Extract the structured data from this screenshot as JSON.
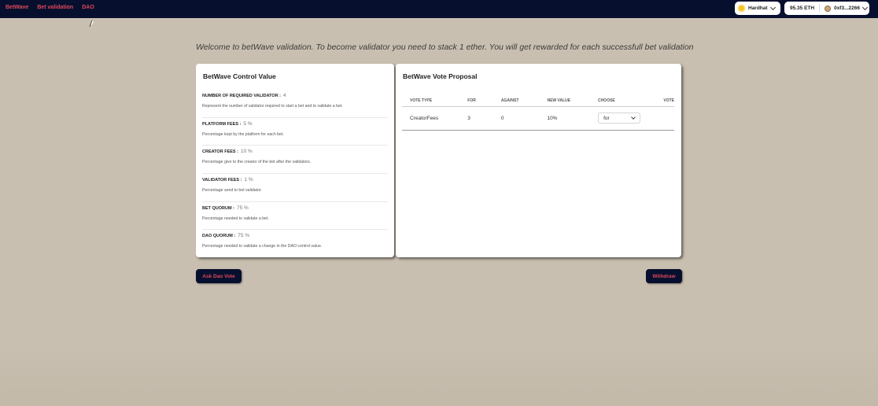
{
  "nav": {
    "brand": "BetWave",
    "links": [
      "Bet validation",
      "DAO"
    ]
  },
  "network": {
    "label": "Hardhat",
    "icon": "sun-icon"
  },
  "wallet": {
    "balance": "95.35 ETH",
    "address": "0xf3...2266"
  },
  "welcome": "Welcome to betWave validation. To become validator you need to stack 1 ether. You will get rewarded for each successfull bet validation",
  "control": {
    "title": "BetWave Control Value",
    "rows": [
      {
        "label": "NUMBER OF REQUIRED VALIDATOR :",
        "value": "4",
        "desc": "Represent the number of validator required to start a bet and to validate a bet."
      },
      {
        "label": "PLATFORM FEES :",
        "value": "5 %",
        "desc": "Percentage kept by the platform for each bet."
      },
      {
        "label": "CREATOR FEES :",
        "value": "10 %",
        "desc": "Percentage give to the creator of the bet after the validators."
      },
      {
        "label": "VALIDATOR FEES :",
        "value": "1 %",
        "desc": "Percentage send to bet validator."
      },
      {
        "label": "BET QUORUM :",
        "value": "75 %",
        "desc": "Percentage needed to validate a bet."
      },
      {
        "label": "DAO QUORUM :",
        "value": "75 %",
        "desc": "Percentage needed to validate a change in the DAO control value."
      }
    ]
  },
  "proposal": {
    "title": "BetWave Vote Proposal",
    "headers": [
      "VOTE TYPE",
      "FOR",
      "AGAINST",
      "NEW VALUE",
      "CHOOSE",
      "VOTE"
    ],
    "rows": [
      {
        "vote_type": "CreatorFees",
        "for": "3",
        "against": "0",
        "new_value": "10%",
        "choose": "for"
      }
    ]
  },
  "buttons": {
    "ask": "Ask Dao Vote",
    "withdraw": "Withdraw"
  },
  "colors": {
    "topbar": "#06102e",
    "accent": "#e0475a",
    "background": "#c9bfb0"
  }
}
